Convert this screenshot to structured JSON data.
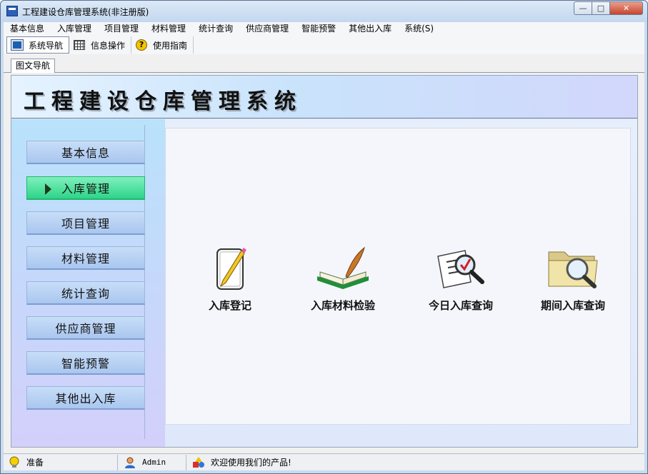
{
  "window": {
    "title": "工程建设仓库管理系统(非注册版)"
  },
  "menu": [
    "基本信息",
    "入库管理",
    "项目管理",
    "材料管理",
    "统计查询",
    "供应商管理",
    "智能预警",
    "其他出入库",
    "系统(S)"
  ],
  "toolbar": {
    "nav": "系统导航",
    "info_ops": "信息操作",
    "guide": "使用指南"
  },
  "tab": {
    "label": "图文导航"
  },
  "header": {
    "title": "工程建设仓库管理系统"
  },
  "sidebar": {
    "selected_index": 1,
    "items": [
      "基本信息",
      "入库管理",
      "项目管理",
      "材料管理",
      "统计查询",
      "供应商管理",
      "智能预警",
      "其他出入库"
    ]
  },
  "functions": [
    {
      "label": "入库登记",
      "icon": "edit-document-icon"
    },
    {
      "label": "入库材料检验",
      "icon": "book-quill-icon"
    },
    {
      "label": "今日入库查询",
      "icon": "checklist-magnifier-icon"
    },
    {
      "label": "期间入库查询",
      "icon": "folder-search-icon"
    }
  ],
  "status": {
    "state": "准备",
    "user": "Admin",
    "message": "欢迎使用我们的产品!"
  },
  "colors": {
    "selected_nav": "#2ed489",
    "nav_button": "#a9c6ef",
    "header_gradient_start": "#e6f3ff"
  }
}
